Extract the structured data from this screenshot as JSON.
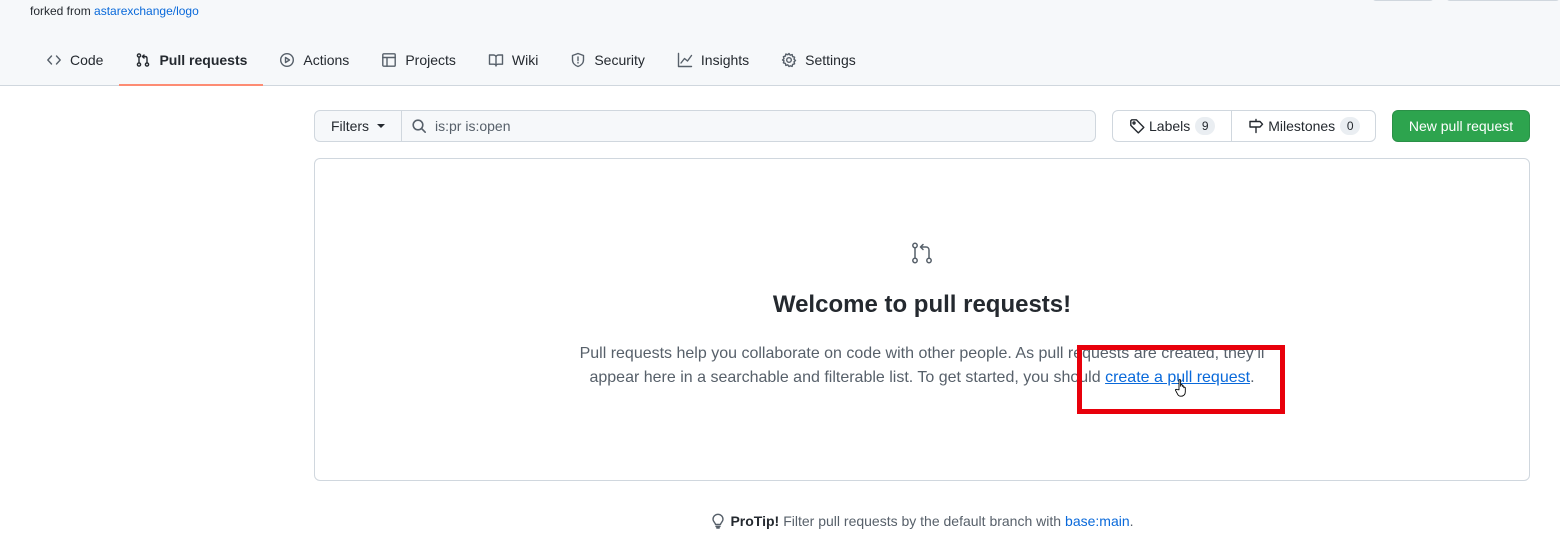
{
  "repo": {
    "forked_prefix": "forked from",
    "forked_link": "astarexchange/logo"
  },
  "tabs": [
    {
      "label": "Code",
      "icon": "code-icon"
    },
    {
      "label": "Pull requests",
      "icon": "git-pull-request-icon",
      "active": true
    },
    {
      "label": "Actions",
      "icon": "play-icon"
    },
    {
      "label": "Projects",
      "icon": "table-icon"
    },
    {
      "label": "Wiki",
      "icon": "book-icon"
    },
    {
      "label": "Security",
      "icon": "shield-icon"
    },
    {
      "label": "Insights",
      "icon": "graph-icon"
    },
    {
      "label": "Settings",
      "icon": "gear-icon"
    }
  ],
  "toolbar": {
    "filters_label": "Filters",
    "search_value": "is:pr is:open",
    "labels_label": "Labels",
    "labels_count": "9",
    "milestones_label": "Milestones",
    "milestones_count": "0",
    "new_pr_label": "New pull request"
  },
  "blankslate": {
    "title": "Welcome to pull requests!",
    "text_before": "Pull requests help you collaborate on code with other people. As pull requests are created, they’ll appear here in a searchable and filterable list. To get started, you should ",
    "link_text": "create a pull request",
    "text_after": "."
  },
  "protip": {
    "label": "ProTip!",
    "text": "Filter pull requests by the default branch with",
    "link": "base:main",
    "suffix": "."
  },
  "colors": {
    "accent_link": "#0969da",
    "primary_button": "#2da44e",
    "active_tab_underline": "#fd8c73",
    "highlight_box": "#e8000b"
  }
}
